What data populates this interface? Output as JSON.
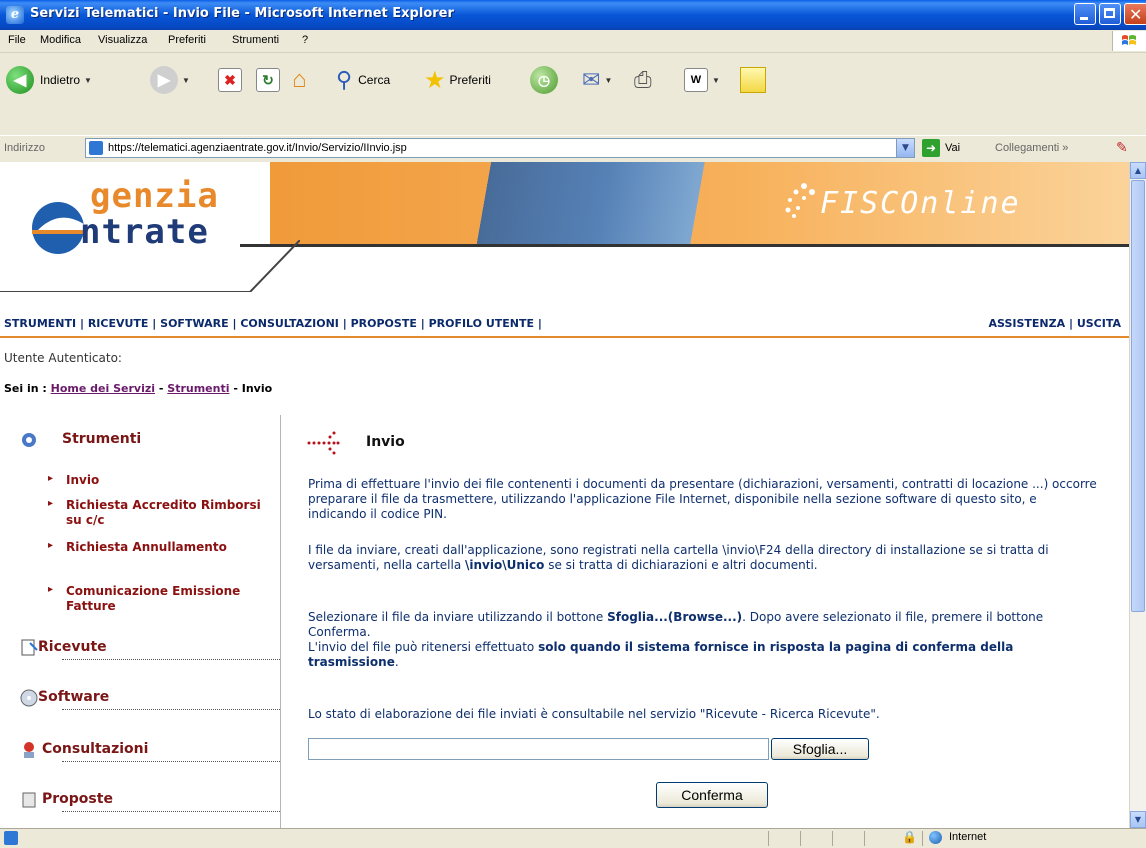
{
  "window": {
    "title": "Servizi Telematici - Invio File - Microsoft Internet Explorer"
  },
  "menu": [
    "File",
    "Modifica",
    "Visualizza",
    "Preferiti",
    "Strumenti",
    "?"
  ],
  "toolbar": {
    "back_label": "Indietro",
    "search_label": "Cerca",
    "favorites_label": "Preferiti"
  },
  "address": {
    "label": "Indirizzo",
    "url": "https://telematici.agenziaentrate.gov.it/Invio/Servizio/IInvio.jsp",
    "go_label": "Vai",
    "links_label": "Collegamenti"
  },
  "banner": {
    "logo_line1": "genzia",
    "logo_line2": "ntrate",
    "brand": "FISCOnline"
  },
  "nav": {
    "left": [
      "STRUMENTI",
      "RICEVUTE",
      "SOFTWARE",
      "CONSULTAZIONI",
      "PROPOSTE",
      "PROFILO UTENTE"
    ],
    "right": [
      "ASSISTENZA",
      "USCITA"
    ]
  },
  "user": {
    "label": "Utente Autenticato:"
  },
  "breadcrumb": {
    "prefix": "Sei in :",
    "home": "Home dei Servizi",
    "strumenti": "Strumenti",
    "current": "Invio"
  },
  "sidebar": {
    "strumenti": "Strumenti",
    "items": [
      "Invio",
      "Richiesta Accredito Rimborsi su c/c",
      "Richiesta Annullamento",
      "Comunicazione Emissione Fatture"
    ],
    "ricevute": "Ricevute",
    "software": "Software",
    "consultazioni": "Consultazioni",
    "proposte": "Proposte"
  },
  "main": {
    "title": "Invio",
    "p1": "Prima di effettuare l'invio dei file contenenti i documenti da presentare (dichiarazioni, versamenti, contratti di locazione ...) occorre preparare il file da trasmettere, utilizzando l'applicazione File Internet, disponibile nella sezione software di questo sito, e indicando il codice PIN.",
    "p2_a": "I file da inviare, creati dall'applicazione, sono registrati nella cartella \\invio\\F24 della directory di installazione se si tratta di versamenti, nella cartella ",
    "p2_b": "\\invio\\Unico",
    "p2_c": " se si tratta di dichiarazioni e altri documenti.",
    "p3_a": "Selezionare il file da inviare utilizzando il bottone ",
    "p3_b": "Sfoglia...(Browse...)",
    "p3_c": ". Dopo avere selezionato il file, premere il bottone Conferma.",
    "p3_d": "L'invio del file può ritenersi effettuato ",
    "p3_e": "solo quando il sistema fornisce in risposta la pagina di conferma della trasmissione",
    "p3_f": ".",
    "p4": "Lo stato di elaborazione dei file inviati è consultabile nel servizio \"Ricevute - Ricerca Ricevute\".",
    "file_value": "",
    "browse_label": "Sfoglia...",
    "confirm_label": "Conferma"
  },
  "status": {
    "zone": "Internet"
  }
}
